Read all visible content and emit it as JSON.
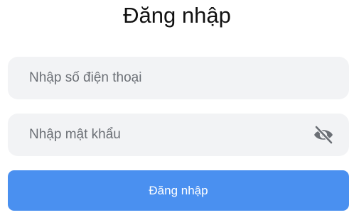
{
  "login": {
    "title": "Đăng nhập",
    "phone": {
      "placeholder": "Nhập số điện thoại",
      "value": ""
    },
    "password": {
      "placeholder": "Nhập mật khẩu",
      "value": "",
      "toggle_icon": "eye-slash-icon"
    },
    "submit_label": "Đăng nhập"
  },
  "colors": {
    "input_bg": "#f2f3f5",
    "button_bg": "#4a90f0",
    "icon": "#6b6f75"
  }
}
